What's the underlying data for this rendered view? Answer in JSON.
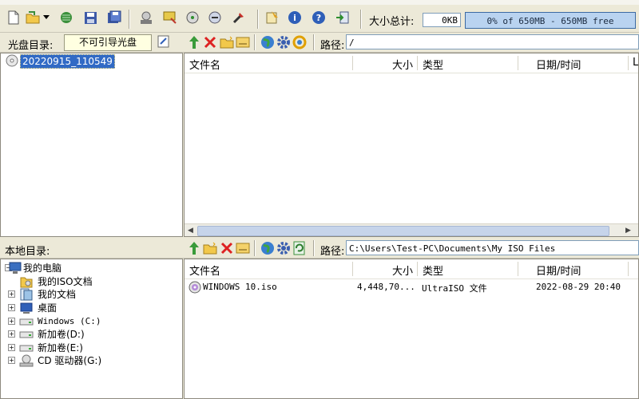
{
  "toolbar": {
    "buttons": [
      {
        "name": "new-button",
        "icon": "new-file-icon"
      },
      {
        "name": "open-button",
        "icon": "open-folder-icon"
      },
      {
        "name": "dropdown-button",
        "icon": "chevron-down-icon"
      },
      {
        "name": "extract-button",
        "icon": "extract-icon"
      },
      {
        "name": "save-button",
        "icon": "floppy-disk-icon"
      },
      {
        "name": "save-as-button",
        "icon": "save-as-icon"
      },
      {
        "name": "make-image-button",
        "icon": "cd-image-icon"
      },
      {
        "name": "burn-button",
        "icon": "burn-icon"
      },
      {
        "name": "mount-button",
        "icon": "virtual-drive-icon"
      },
      {
        "name": "compress-button",
        "icon": "compress-icon"
      },
      {
        "name": "properties-button",
        "icon": "tools-icon"
      },
      {
        "name": "option-button",
        "icon": "option-icon"
      },
      {
        "name": "info-button",
        "icon": "info-icon"
      },
      {
        "name": "help-button",
        "icon": "help-icon"
      },
      {
        "name": "exit-button",
        "icon": "exit-icon"
      }
    ],
    "total_label": "大小总计:",
    "total_size": "0KB",
    "capacity": "0% of 650MB - 650MB free",
    "colors": {
      "capacity_fill": "#b9d3f0",
      "capacity_border": "#3c6aa3"
    }
  },
  "cd_pane": {
    "label": "光盘目录:",
    "boot_status": "不可引导光盘",
    "tree": [
      {
        "label": "20220915_110549",
        "selected": true
      }
    ],
    "toolbar_icons": [
      "up-arrow-icon",
      "delete-icon",
      "new-folder-icon",
      "rename-icon",
      "world-icon",
      "gear-icon",
      "refresh-icon"
    ],
    "path_label": "路径:",
    "path": "/",
    "columns": [
      "文件名",
      "大小",
      "类型",
      "日期/时间",
      "L"
    ],
    "files": []
  },
  "local_pane": {
    "label": "本地目录:",
    "tree": [
      {
        "label": "我的电脑",
        "icon": "computer-icon",
        "expander": "minus"
      },
      {
        "label": "我的ISO文档",
        "icon": "folder-icon",
        "expander": ""
      },
      {
        "label": "我的文档",
        "icon": "documents-icon",
        "expander": "plus"
      },
      {
        "label": "桌面",
        "icon": "desktop-icon",
        "expander": "plus"
      },
      {
        "label": "Windows (C:)",
        "icon": "drive-icon",
        "expander": "plus"
      },
      {
        "label": "新加卷(D:)",
        "icon": "drive-icon",
        "expander": "plus"
      },
      {
        "label": "新加卷(E:)",
        "icon": "drive-icon",
        "expander": "plus"
      },
      {
        "label": "CD 驱动器(G:)",
        "icon": "cd-drive-icon",
        "expander": "plus"
      }
    ],
    "toolbar_icons": [
      "up-arrow-icon",
      "new-folder-icon",
      "delete-icon",
      "rename-icon",
      "world-icon",
      "gear-icon",
      "refresh-icon"
    ],
    "path_label": "路径:",
    "path": "C:\\Users\\Test-PC\\Documents\\My ISO Files",
    "columns": [
      "文件名",
      "大小",
      "类型",
      "日期/时间"
    ],
    "files": [
      {
        "name": "WINDOWS 10.iso",
        "size": "4,448,70...",
        "type": "UltraISO 文件",
        "date": "2022-08-29 20:40"
      }
    ]
  }
}
